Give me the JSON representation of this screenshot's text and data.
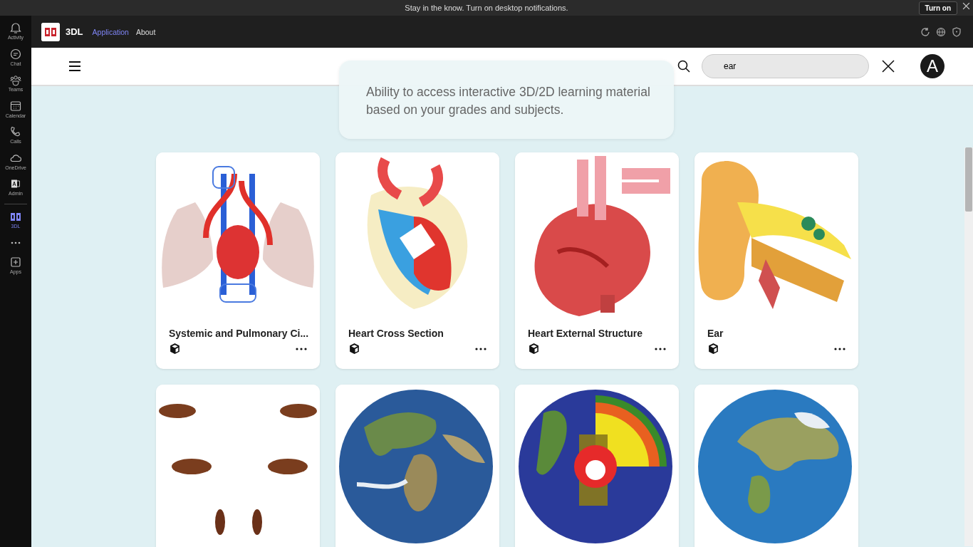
{
  "notification": {
    "text": "Stay in the know. Turn on desktop notifications.",
    "button": "Turn on"
  },
  "rail": [
    {
      "label": "Activity",
      "selected": false
    },
    {
      "label": "Chat",
      "selected": false
    },
    {
      "label": "Teams",
      "selected": false
    },
    {
      "label": "Calendar",
      "selected": false
    },
    {
      "label": "Calls",
      "selected": false
    },
    {
      "label": "OneDrive",
      "selected": false
    },
    {
      "label": "Admin",
      "selected": false
    },
    {
      "label": "3DL",
      "selected": true
    },
    {
      "label": "Apps",
      "selected": false
    }
  ],
  "app": {
    "name": "3DL",
    "tabs": [
      {
        "label": "Application",
        "selected": true
      },
      {
        "label": "About",
        "selected": false
      }
    ]
  },
  "search": {
    "value": "ear"
  },
  "avatar": "A",
  "tooltip": "Ability to access interactive 3D/2D learning material based on your grades and subjects.",
  "cards": [
    {
      "title": "Systemic and Pulmonary Ci..."
    },
    {
      "title": "Heart Cross Section"
    },
    {
      "title": "Heart External Structure"
    },
    {
      "title": "Ear"
    },
    {
      "kind": "picture"
    },
    {
      "kind": "picture"
    },
    {
      "kind": "picture"
    },
    {
      "kind": "picture"
    }
  ]
}
